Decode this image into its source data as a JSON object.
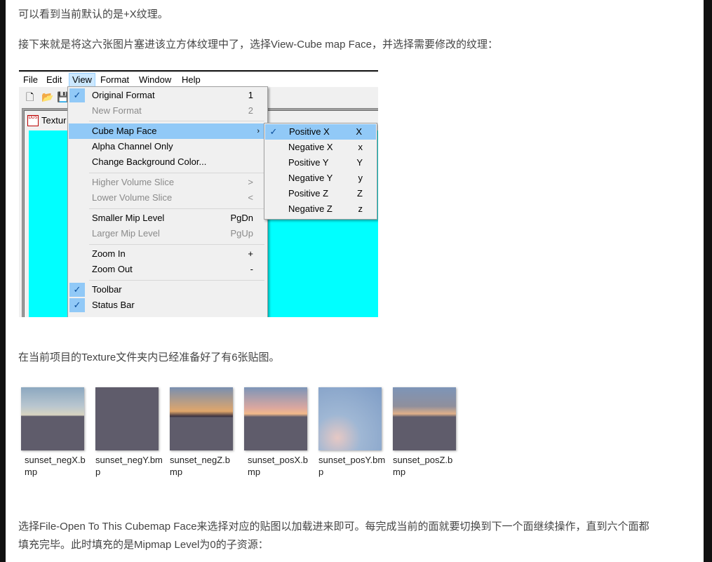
{
  "article": {
    "p1": "可以看到当前默认的是+X纹理。",
    "p2": "接下来就是将这六张图片塞进该立方体纹理中了，选择View-Cube map Face，并选择需要修改的纹理：",
    "p3": "在当前项目的Texture文件夹内已经准备好了有6张贴图。",
    "p4_line1": "选择File-Open To This Cubemap Face来选择对应的贴图以加载进来即可。每完成当前的面就要切换到下一个面继续操作，直到六个面都",
    "p4_line2": "填充完毕。此时填充的是Mipmap Level为0的子资源："
  },
  "screenshot": {
    "menubar": [
      "File",
      "Edit",
      "View",
      "Format",
      "Window",
      "Help"
    ],
    "active_menu": "View",
    "child_window_title": "Textur",
    "child_icon_text": "DDS",
    "view_menu": [
      {
        "label": "Original Format",
        "shortcut": "1",
        "checked": true,
        "disabled": false
      },
      {
        "label": "New Format",
        "shortcut": "2",
        "checked": false,
        "disabled": true
      },
      {
        "label": "Cube Map Face",
        "shortcut": "›",
        "checked": false,
        "disabled": false,
        "highlight": true
      },
      {
        "label": "Alpha Channel Only",
        "shortcut": "",
        "checked": false,
        "disabled": false
      },
      {
        "label": "Change Background Color...",
        "shortcut": "",
        "checked": false,
        "disabled": false
      },
      {
        "label": "Higher Volume Slice",
        "shortcut": ">",
        "checked": false,
        "disabled": true
      },
      {
        "label": "Lower Volume Slice",
        "shortcut": "<",
        "checked": false,
        "disabled": true
      },
      {
        "label": "Smaller Mip Level",
        "shortcut": "PgDn",
        "checked": false,
        "disabled": false
      },
      {
        "label": "Larger Mip Level",
        "shortcut": "PgUp",
        "checked": false,
        "disabled": true
      },
      {
        "label": "Zoom In",
        "shortcut": "+",
        "checked": false,
        "disabled": false
      },
      {
        "label": "Zoom Out",
        "shortcut": "-",
        "checked": false,
        "disabled": false
      },
      {
        "label": "Toolbar",
        "shortcut": "",
        "checked": true,
        "disabled": false
      },
      {
        "label": "Status Bar",
        "shortcut": "",
        "checked": true,
        "disabled": false
      }
    ],
    "cube_submenu": [
      {
        "label": "Positive X",
        "shortcut": "X",
        "checked": true
      },
      {
        "label": "Negative X",
        "shortcut": "x",
        "checked": false
      },
      {
        "label": "Positive Y",
        "shortcut": "Y",
        "checked": false
      },
      {
        "label": "Negative Y",
        "shortcut": "y",
        "checked": false
      },
      {
        "label": "Positive Z",
        "shortcut": "Z",
        "checked": false
      },
      {
        "label": "Negative Z",
        "shortcut": "z",
        "checked": false
      }
    ]
  },
  "thumbnails": [
    {
      "caption": "sunset_negX.bmp"
    },
    {
      "caption": "sunset_negY.bmp"
    },
    {
      "caption": "sunset_negZ.bmp"
    },
    {
      "caption": "sunset_posX.bmp"
    },
    {
      "caption": "sunset_posY.bmp"
    },
    {
      "caption": "sunset_posZ.bmp"
    }
  ],
  "colors": {
    "highlight": "#91c9f7",
    "cyan_canvas": "#00ffff",
    "menu_bg": "#f0f0f0"
  }
}
